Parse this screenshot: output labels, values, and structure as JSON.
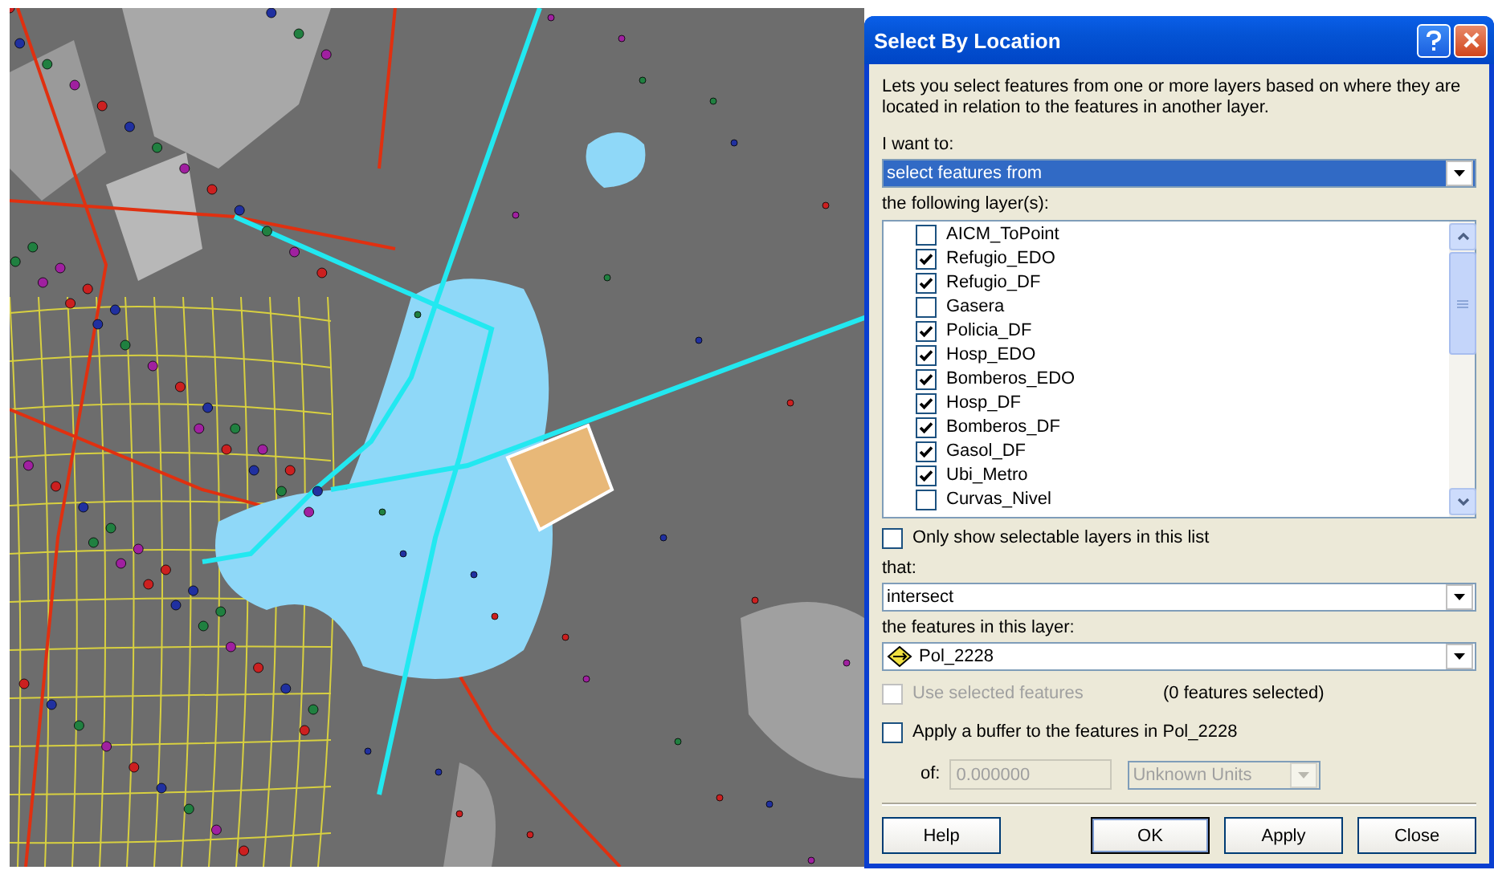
{
  "window": {
    "title": "Select By Location"
  },
  "description": "Lets you select features from one or more layers based on where they are located in relation to the features in another layer.",
  "method": {
    "label": "I want to:",
    "value": "select features from"
  },
  "layers": {
    "label": "the following layer(s):",
    "items": [
      {
        "name": "AICM_ToPoint",
        "checked": false
      },
      {
        "name": "Refugio_EDO",
        "checked": true
      },
      {
        "name": "Refugio_DF",
        "checked": true
      },
      {
        "name": "Gasera",
        "checked": false
      },
      {
        "name": "Policia_DF",
        "checked": true
      },
      {
        "name": "Hosp_EDO",
        "checked": true
      },
      {
        "name": "Bomberos_EDO",
        "checked": true
      },
      {
        "name": "Hosp_DF",
        "checked": true
      },
      {
        "name": "Bomberos_DF",
        "checked": true
      },
      {
        "name": "Gasol_DF",
        "checked": true
      },
      {
        "name": "Ubi_Metro",
        "checked": true
      },
      {
        "name": "Curvas_Nivel",
        "checked": false
      }
    ]
  },
  "only_selectable": {
    "label": "Only show selectable layers in this list",
    "checked": false
  },
  "relation": {
    "label": "that:",
    "value": "intersect"
  },
  "source": {
    "label": "the features in this layer:",
    "value": "Pol_2228"
  },
  "use_selected": {
    "label": "Use selected features",
    "checked": false,
    "disabled": true
  },
  "selected_count": "(0 features selected)",
  "buffer": {
    "label": "Apply a buffer to the features in Pol_2228",
    "checked": false,
    "distance_label": "of:",
    "distance": "0.000000",
    "units": "Unknown Units",
    "disabled": true
  },
  "buttons": [
    {
      "label": "Help",
      "default": false
    },
    {
      "label": "OK",
      "default": true
    },
    {
      "label": "Apply",
      "default": false
    },
    {
      "label": "Close",
      "default": false
    }
  ]
}
